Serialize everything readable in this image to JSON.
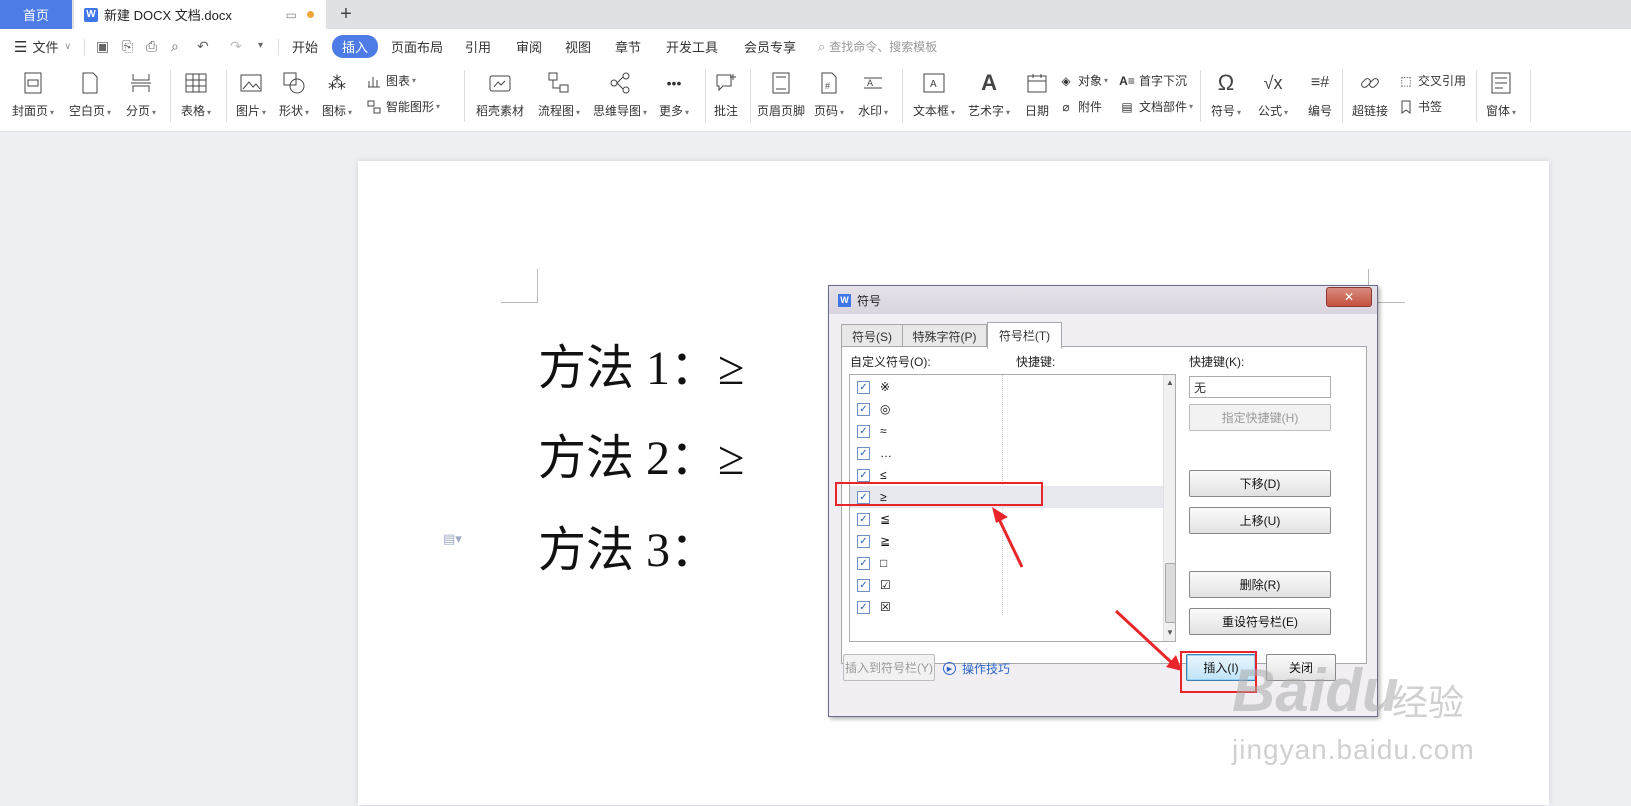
{
  "tabs": {
    "home_label": "首页",
    "doc_title": "新建 DOCX 文档.docx",
    "new_tab": "+"
  },
  "menu": {
    "file": "文件",
    "items": [
      "开始",
      "插入",
      "页面布局",
      "引用",
      "审阅",
      "视图",
      "章节",
      "开发工具",
      "会员专享"
    ],
    "active": "插入",
    "search_placeholder": "查找命令、搜索模板"
  },
  "ribbon": {
    "cover": "封面页",
    "blank": "空白页",
    "page_break": "分页",
    "table": "表格",
    "picture": "图片",
    "shape": "形状",
    "icon": "图标",
    "chart": "图表",
    "smart_art": "智能图形",
    "stock_material": "稻壳素材",
    "flowchart": "流程图",
    "mindmap": "思维导图",
    "more": "更多",
    "comment": "批注",
    "header_footer": "页眉页脚",
    "page_number": "页码",
    "watermark": "水印",
    "textbox": "文本框",
    "wordart": "艺术字",
    "date": "日期",
    "object": "对象",
    "attachment": "附件",
    "drop_cap": "首字下沉",
    "doc_parts": "文档部件",
    "symbol": "符号",
    "formula": "公式",
    "numbering": "编号",
    "hyperlink": "超链接",
    "cross_ref": "交叉引用",
    "bookmark": "书签",
    "window": "窗体"
  },
  "document": {
    "lines": [
      "方法 1：≥",
      "方法 2：≥",
      "方法 3："
    ]
  },
  "dialog": {
    "title": "符号",
    "close": "✕",
    "tabs": [
      "符号(S)",
      "特殊字符(P)",
      "符号栏(T)"
    ],
    "active_tab": "符号栏(T)",
    "col_custom": "自定义符号(O):",
    "col_hotkey": "快捷键:",
    "hotkey_label": "快捷键(K):",
    "hotkey_value": "无",
    "symbols": [
      "※",
      "◎",
      "≈",
      "…",
      "≤",
      "≥",
      "≦",
      "≧",
      "□",
      "☑",
      "☒"
    ],
    "selected_symbol": "≥",
    "buttons": {
      "assign_hotkey": "指定快捷键(H)",
      "move_down": "下移(D)",
      "move_up": "上移(U)",
      "delete": "删除(R)",
      "reset": "重设符号栏(E)",
      "insert_to_bar": "插入到符号栏(Y)",
      "tips": "操作技巧",
      "insert": "插入(I)",
      "close": "关闭"
    }
  },
  "watermark": {
    "logo": "Baidu",
    "text": "经验",
    "url": "jingyan.baidu.com"
  },
  "colors": {
    "accent": "#4d7ce6",
    "annotation_red": "#e8262a"
  }
}
